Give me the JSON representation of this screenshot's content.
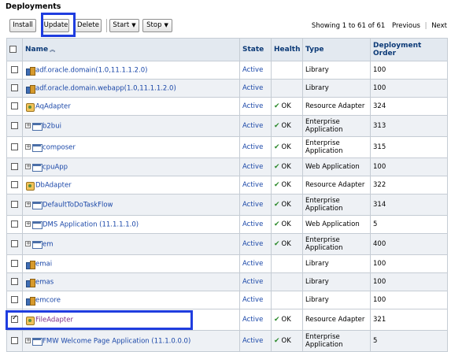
{
  "page": {
    "title": "Deployments"
  },
  "toolbar": {
    "install": "Install",
    "update": "Update",
    "delete": "Delete",
    "start": "Start",
    "stop": "Stop"
  },
  "pager": {
    "summary": "Showing 1 to 61 of 61",
    "previous": "Previous",
    "next": "Next"
  },
  "table": {
    "headers": {
      "name": "Name",
      "state": "State",
      "health": "Health",
      "type": "Type",
      "order_line1": "Deployment",
      "order_line2": "Order"
    },
    "rows": [
      {
        "name": "adf.oracle.domain(1.0,11.1.1.2.0)",
        "state": "Active",
        "health": "",
        "type": "Library",
        "order": "100"
      },
      {
        "name": "adf.oracle.domain.webapp(1.0,11.1.1.2.0)",
        "state": "Active",
        "health": "",
        "type": "Library",
        "order": "100"
      },
      {
        "name": "AqAdapter",
        "state": "Active",
        "health": "OK",
        "type": "Resource Adapter",
        "order": "324"
      },
      {
        "name": "b2bui",
        "state": "Active",
        "health": "OK",
        "type": "Enterprise Application",
        "type_line1": "Enterprise",
        "type_line2": "Application",
        "order": "313"
      },
      {
        "name": "composer",
        "state": "Active",
        "health": "OK",
        "type": "Enterprise Application",
        "type_line1": "Enterprise",
        "type_line2": "Application",
        "order": "315"
      },
      {
        "name": "cpuApp",
        "state": "Active",
        "health": "OK",
        "type": "Web Application",
        "order": "100"
      },
      {
        "name": "DbAdapter",
        "state": "Active",
        "health": "OK",
        "type": "Resource Adapter",
        "order": "322"
      },
      {
        "name": "DefaultToDoTaskFlow",
        "state": "Active",
        "health": "OK",
        "type": "Enterprise Application",
        "type_line1": "Enterprise",
        "type_line2": "Application",
        "order": "314"
      },
      {
        "name": "DMS Application (11.1.1.1.0)",
        "state": "Active",
        "health": "OK",
        "type": "Web Application",
        "order": "5"
      },
      {
        "name": "em",
        "state": "Active",
        "health": "OK",
        "type": "Enterprise Application",
        "type_line1": "Enterprise",
        "type_line2": "Application",
        "order": "400"
      },
      {
        "name": "emai",
        "state": "Active",
        "health": "",
        "type": "Library",
        "order": "100"
      },
      {
        "name": "emas",
        "state": "Active",
        "health": "",
        "type": "Library",
        "order": "100"
      },
      {
        "name": "emcore",
        "state": "Active",
        "health": "",
        "type": "Library",
        "order": "100"
      },
      {
        "name": "FileAdapter",
        "state": "Active",
        "health": "OK",
        "type": "Resource Adapter",
        "order": "321"
      },
      {
        "name": "FMW Welcome Page Application (11.1.0.0.0)",
        "state": "Active",
        "health": "OK",
        "type": "Enterprise Application",
        "type_line1": "Enterprise",
        "type_line2": "Application",
        "order": "5"
      }
    ]
  },
  "colors": {
    "header_text": "#0c3a77",
    "link": "#1a47a8",
    "visited_link": "#7b2a86",
    "ok_check": "#2e8b2e",
    "highlight_box": "#1f3ddf"
  }
}
